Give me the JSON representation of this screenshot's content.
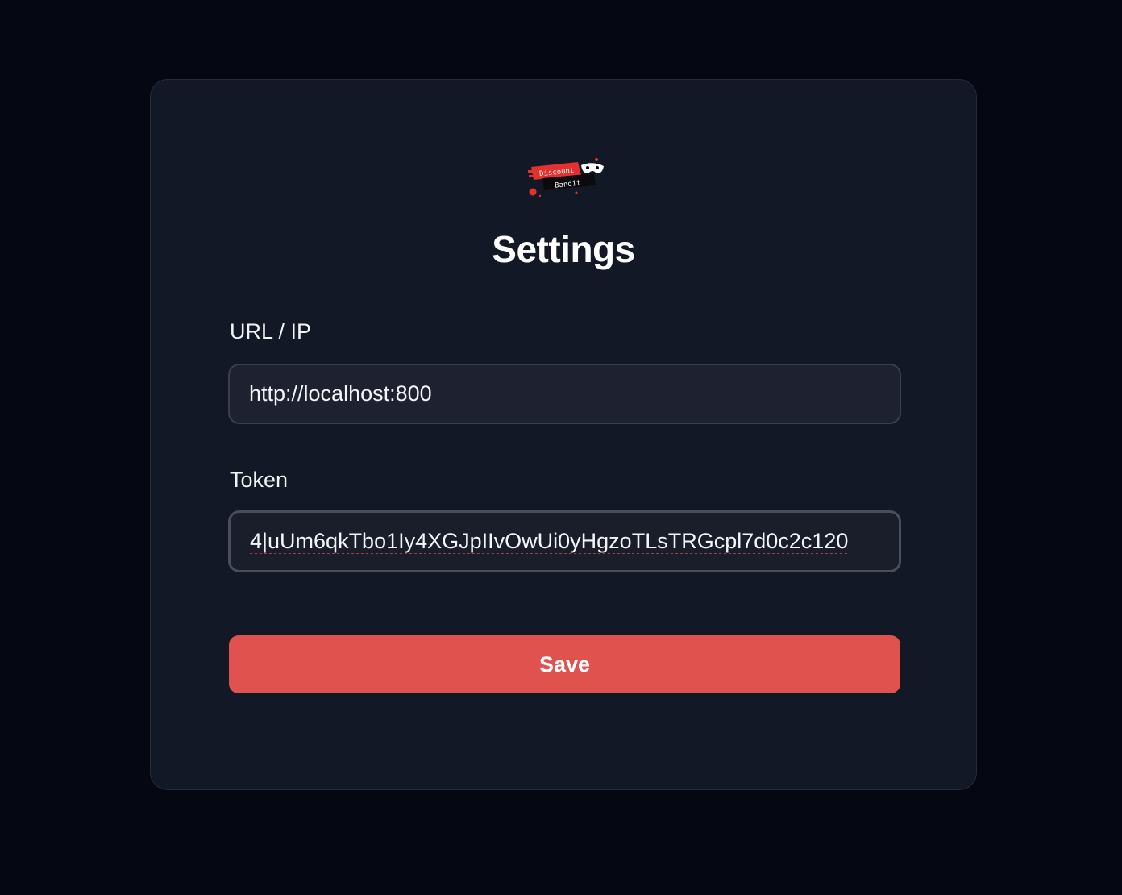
{
  "logo": {
    "line1": "Discount",
    "line2": "Bandit",
    "brand_red": "#e3322e",
    "mask_icon": "bandit-mask-icon"
  },
  "page": {
    "title": "Settings"
  },
  "form": {
    "url": {
      "label": "URL / IP",
      "value": "http://localhost:800"
    },
    "token": {
      "label": "Token",
      "value": "4|uUm6qkTbo1Iy4XGJpIIvOwUi0yHgzoTLsTRGcpl7d0c2c120"
    },
    "save_label": "Save"
  },
  "colors": {
    "background": "#050712",
    "card": "#131826",
    "accent": "#df524e"
  }
}
